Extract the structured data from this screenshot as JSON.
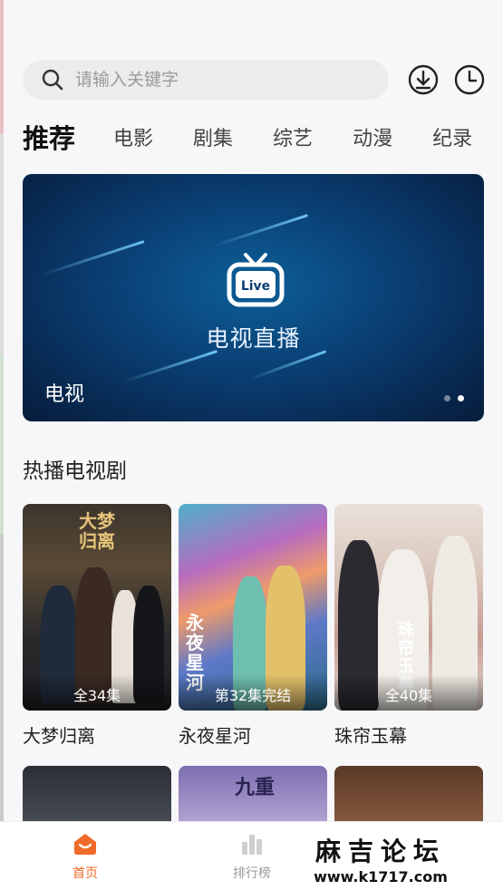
{
  "search": {
    "placeholder": "请输入关键字"
  },
  "header_icons": [
    "download-icon",
    "history-icon"
  ],
  "tabs": [
    {
      "label": "推荐",
      "active": true
    },
    {
      "label": "电影"
    },
    {
      "label": "剧集"
    },
    {
      "label": "综艺"
    },
    {
      "label": "动漫"
    },
    {
      "label": "纪录"
    }
  ],
  "banner": {
    "badge_text": "Live",
    "title": "电视直播",
    "caption": "电视",
    "page_count": 2,
    "current_page": 2
  },
  "section": {
    "title": "热播电视剧"
  },
  "dramas": [
    {
      "title": "大梦归离",
      "episodes": "全34集",
      "poster_text": "大梦归离"
    },
    {
      "title": "永夜星河",
      "episodes": "第32集完结",
      "poster_text": "永夜星河"
    },
    {
      "title": "珠帘玉幕",
      "episodes": "全40集",
      "poster_text": "珠帘玉幕"
    }
  ],
  "row2_poster_text": "九重",
  "nav": {
    "home": "首页",
    "rank": "排行榜"
  },
  "watermark": {
    "title": "麻吉论坛",
    "url": "www.k1717.com"
  },
  "colors": {
    "accent": "#f06a2a",
    "banner_bg": "#0a3f74"
  }
}
